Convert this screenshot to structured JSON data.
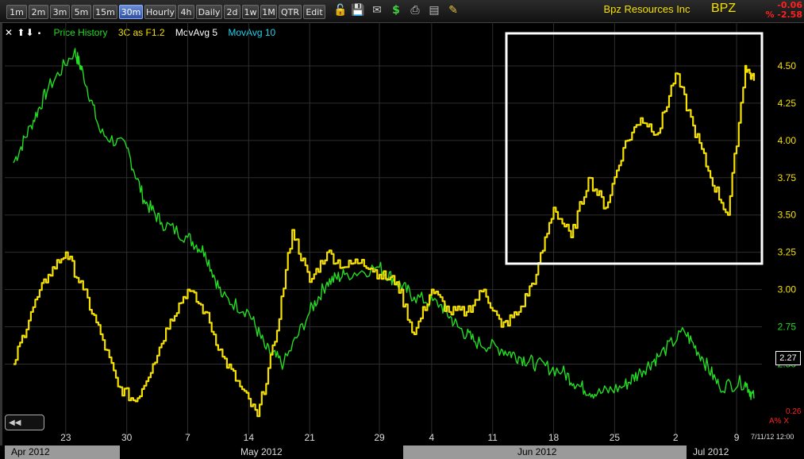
{
  "toolbar": {
    "timeframes": [
      "1m",
      "2m",
      "3m",
      "5m",
      "15m",
      "30m",
      "Hourly",
      "4h",
      "Daily",
      "2d",
      "1w",
      "1M",
      "QTR",
      "Edit"
    ],
    "active_timeframe": "30m",
    "icons": [
      "lock-icon",
      "save-icon",
      "email-icon",
      "dollar-icon",
      "print-icon",
      "compose-icon",
      "pencil-icon"
    ],
    "company": "Bpz Resources Inc",
    "symbol": "BPZ",
    "change": "-0.06",
    "change_pct": "% -2.58"
  },
  "legend": {
    "icons": "✕ ⬆⬇ ⬝",
    "items": [
      {
        "label": "Price History",
        "color": "#22dd22"
      },
      {
        "label": "3C as F1.2",
        "color": "#f5e000"
      },
      {
        "label": "MovAvg 5",
        "color": "#ffffff"
      },
      {
        "label": "MovAvg 10",
        "color": "#22d3ee"
      }
    ]
  },
  "chart_data": {
    "type": "line",
    "y_ticks": [
      "4.50",
      "4.25",
      "4.00",
      "3.75",
      "3.50",
      "3.25",
      "3.00",
      "2.75",
      "2.50"
    ],
    "y_tick_values": [
      4.5,
      4.25,
      4.0,
      3.75,
      3.5,
      3.25,
      3.0,
      2.75,
      2.5
    ],
    "ylim": [
      2.05,
      4.75
    ],
    "x_ticks": [
      "23",
      "30",
      "7",
      "14",
      "21",
      "29",
      "4",
      "11",
      "18",
      "25",
      "2",
      "9"
    ],
    "x_tick_dates": [
      "2012-04-23",
      "2012-04-30",
      "2012-05-07",
      "2012-05-14",
      "2012-05-21",
      "2012-05-29",
      "2012-06-04",
      "2012-06-11",
      "2012-06-18",
      "2012-06-25",
      "2012-07-02",
      "2012-07-09"
    ],
    "months": [
      "Apr 2012",
      "May 2012",
      "Jun 2012",
      "Jul 2012"
    ],
    "last_price": "2.27",
    "extra_label": "0.26",
    "al_label": "A% X",
    "timestamp": "7/11/12 12:00",
    "highlight_box": true,
    "series": [
      {
        "color": "#22dd22",
        "x": [
          "2012-04-17",
          "2012-04-19",
          "2012-04-21",
          "2012-04-24",
          "2012-04-25",
          "2012-04-27",
          "2012-04-30",
          "2012-05-02",
          "2012-05-04",
          "2012-05-07",
          "2012-05-09",
          "2012-05-11",
          "2012-05-14",
          "2012-05-16",
          "2012-05-18",
          "2012-05-21",
          "2012-05-23",
          "2012-05-25",
          "2012-05-29",
          "2012-05-31",
          "2012-06-02",
          "2012-06-05",
          "2012-06-07",
          "2012-06-09",
          "2012-06-12",
          "2012-06-14",
          "2012-06-16",
          "2012-06-19",
          "2012-06-21",
          "2012-06-23",
          "2012-06-26",
          "2012-06-28",
          "2012-06-30",
          "2012-07-03",
          "2012-07-05",
          "2012-07-07",
          "2012-07-10",
          "2012-07-11"
        ],
        "values": [
          3.85,
          4.1,
          4.35,
          4.6,
          4.45,
          4.05,
          3.95,
          3.6,
          3.45,
          3.35,
          3.25,
          2.95,
          2.85,
          2.6,
          2.5,
          2.85,
          3.05,
          3.1,
          3.15,
          3.05,
          2.95,
          2.9,
          2.75,
          2.65,
          2.6,
          2.55,
          2.5,
          2.45,
          2.35,
          2.3,
          2.35,
          2.45,
          2.55,
          2.72,
          2.55,
          2.35,
          2.38,
          2.27
        ]
      },
      {
        "color": "#f5e000",
        "x": [
          "2012-04-17",
          "2012-04-19",
          "2012-04-21",
          "2012-04-23",
          "2012-04-25",
          "2012-04-27",
          "2012-04-29",
          "2012-05-01",
          "2012-05-03",
          "2012-05-05",
          "2012-05-07",
          "2012-05-09",
          "2012-05-11",
          "2012-05-13",
          "2012-05-15",
          "2012-05-17",
          "2012-05-19",
          "2012-05-21",
          "2012-05-23",
          "2012-05-25",
          "2012-05-27",
          "2012-05-29",
          "2012-05-31",
          "2012-06-02",
          "2012-06-04",
          "2012-06-06",
          "2012-06-08",
          "2012-06-10",
          "2012-06-12",
          "2012-06-14",
          "2012-06-16",
          "2012-06-18",
          "2012-06-20",
          "2012-06-22",
          "2012-06-24",
          "2012-06-26",
          "2012-06-28",
          "2012-06-30",
          "2012-07-02",
          "2012-07-04",
          "2012-07-06",
          "2012-07-08",
          "2012-07-10",
          "2012-07-11"
        ],
        "values": [
          2.5,
          2.85,
          3.1,
          3.25,
          3.0,
          2.7,
          2.35,
          2.25,
          2.5,
          2.8,
          3.0,
          2.85,
          2.55,
          2.35,
          2.15,
          2.65,
          3.4,
          3.05,
          3.25,
          3.15,
          3.2,
          3.1,
          3.05,
          2.7,
          3.0,
          2.85,
          2.85,
          3.0,
          2.75,
          2.85,
          3.1,
          3.55,
          3.35,
          3.75,
          3.55,
          3.95,
          4.15,
          4.05,
          4.45,
          4.1,
          3.75,
          3.5,
          4.5,
          4.4
        ]
      }
    ]
  }
}
